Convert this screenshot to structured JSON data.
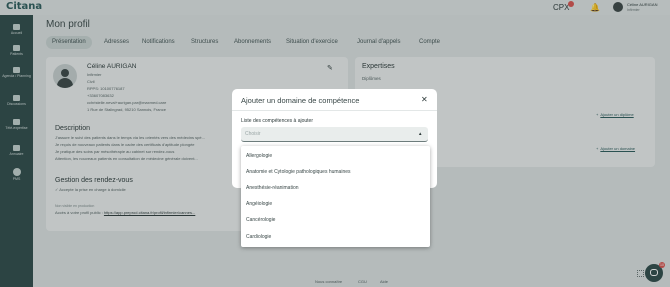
{
  "brand": {
    "logo": "Citana"
  },
  "topbar": {
    "cpx": "CPX",
    "user_name": "Céline AURIGAN",
    "user_role": "Infirmier"
  },
  "sidebar": {
    "items": [
      {
        "label": "Accueil",
        "icon": "home-icon"
      },
      {
        "label": "Patients",
        "icon": "patients-icon"
      },
      {
        "label": "Agenda / Planning",
        "icon": "calendar-icon"
      },
      {
        "label": "Discussions",
        "icon": "chat-icon"
      },
      {
        "label": "Télé-expertise",
        "icon": "telexpertise-icon"
      },
      {
        "label": "Annuaire",
        "icon": "directory-icon"
      },
      {
        "label": "PMS",
        "icon": "user-icon"
      }
    ]
  },
  "page": {
    "title": "Mon profil"
  },
  "tabs": [
    "Présentation",
    "Adresses",
    "Notifications",
    "Structures",
    "Abonnements",
    "Situation d'exercice",
    "Journal d'appels",
    "Compte"
  ],
  "profile": {
    "name": "Céline AURIGAN",
    "lines": [
      "Infirmier",
      "Civil",
      "RPPS: 10100776187",
      "+33607083632",
      "cchristelle.neval+aurigan.par@maxmed.care",
      "1 Rue de Stalingrad, 95210 Sannois, France"
    ]
  },
  "description": {
    "title": "Description",
    "lines": [
      "J'assure le suivi des patients dans le temps via les orientés vers des médecins spé...",
      "Je reçois de nouveaux patients dans le cadre des certificats d'aptitude plongée",
      "Je pratique des soins par mésothérapie au cabinet sur rendez-vous",
      "Attention, les nouveaux patients en consultation de médecine générale doivent..."
    ]
  },
  "appointments": {
    "title": "Gestion des rendez-vous",
    "accept": "Accepte la prise en charge à domicile",
    "muted": "Non visible en production",
    "public_prefix": "Accès à votre profil public : ",
    "public_url": "https://app.preprod.citana.fr/profil/infirmier/cannes..."
  },
  "expertises": {
    "title": "Expertises",
    "diplomas": "Diplômes",
    "add_diploma": "Ajouter un diplôme",
    "add_domain": "Ajouter un domaine"
  },
  "modal": {
    "title": "Ajouter un domaine de compétence",
    "field_label": "Liste des compétences à ajouter",
    "placeholder": "Choisir",
    "options": [
      "Allergologie",
      "Anatomie et Cytologie pathologiques humaines",
      "Anesthésie-réanimation",
      "Angéiologie",
      "Cancérologie",
      "Cardiologie"
    ]
  },
  "footer": {
    "links": [
      "Nous connaître",
      "CGU",
      "Aide"
    ]
  },
  "chat": {
    "badge": "10"
  }
}
